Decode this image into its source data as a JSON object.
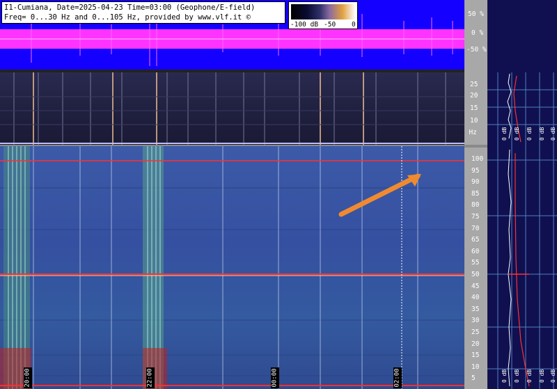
{
  "header": {
    "line1": "I1-Cumiana, Date=2025-04-23 Time=03:00 (Geophone/E-field)",
    "line2": "Freq= 0...30 Hz and 0...105 Hz, provided by www.vlf.it ©"
  },
  "colorbar": {
    "min_label": "-100 dB",
    "mid_label": "-50",
    "max_label": "0"
  },
  "waveform_scale": [
    "50 %",
    "0 %",
    "-50 %"
  ],
  "low_freq_scale": [
    "25",
    "20",
    "15",
    "10",
    "5 Hz"
  ],
  "main_freq_scale": [
    "100",
    "95",
    "90",
    "85",
    "80",
    "75",
    "70",
    "65",
    "60",
    "55",
    "50",
    "45",
    "40",
    "35",
    "30",
    "25",
    "20",
    "15",
    "10",
    "5"
  ],
  "time_labels": [
    "20:00",
    "22:00",
    "00:00",
    "02:00"
  ],
  "side_labels_mid": [
    "0 dB",
    "0 dB",
    "0 dB",
    "0 dB",
    "0 dB"
  ],
  "side_labels_bot": [
    "0 dB",
    "0 dB",
    "0 dB",
    "0 dB",
    "0 dB"
  ],
  "colors": {
    "waveform_bg": "#1400ff",
    "waveform_band": "#ff33ff",
    "spectrogram_main": "#3550a0",
    "arrow": "#f08a30",
    "line_red": "#ff3030"
  }
}
